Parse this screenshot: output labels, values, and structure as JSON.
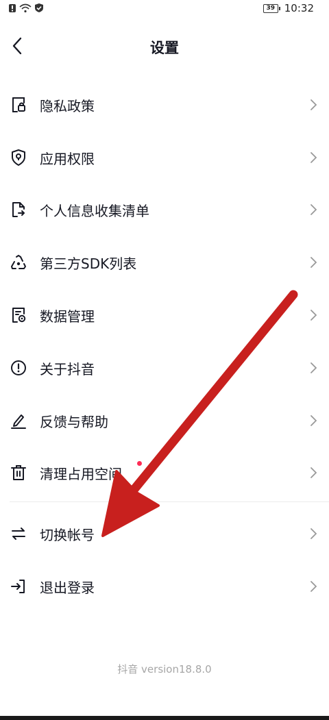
{
  "status_bar": {
    "battery": "39",
    "time": "10:32"
  },
  "header": {
    "title": "设置"
  },
  "menu": {
    "items": [
      {
        "label": "隐私政策",
        "icon": "privacy-lock-icon"
      },
      {
        "label": "应用权限",
        "icon": "shield-icon"
      },
      {
        "label": "个人信息收集清单",
        "icon": "document-icon"
      },
      {
        "label": "第三方SDK列表",
        "icon": "recycle-icon"
      },
      {
        "label": "数据管理",
        "icon": "data-gear-icon"
      },
      {
        "label": "关于抖音",
        "icon": "info-circle-icon"
      },
      {
        "label": "反馈与帮助",
        "icon": "pencil-icon"
      },
      {
        "label": "清理占用空间",
        "icon": "trash-icon"
      },
      {
        "label": "切换帐号",
        "icon": "switch-arrows-icon"
      },
      {
        "label": "退出登录",
        "icon": "logout-icon"
      }
    ]
  },
  "footer": {
    "version": "抖音 version18.8.0"
  },
  "colors": {
    "annotation_arrow": "#c8201e",
    "notification_dot": "#fe2c55",
    "text_primary": "#161823",
    "text_secondary": "#a6a6a6"
  }
}
